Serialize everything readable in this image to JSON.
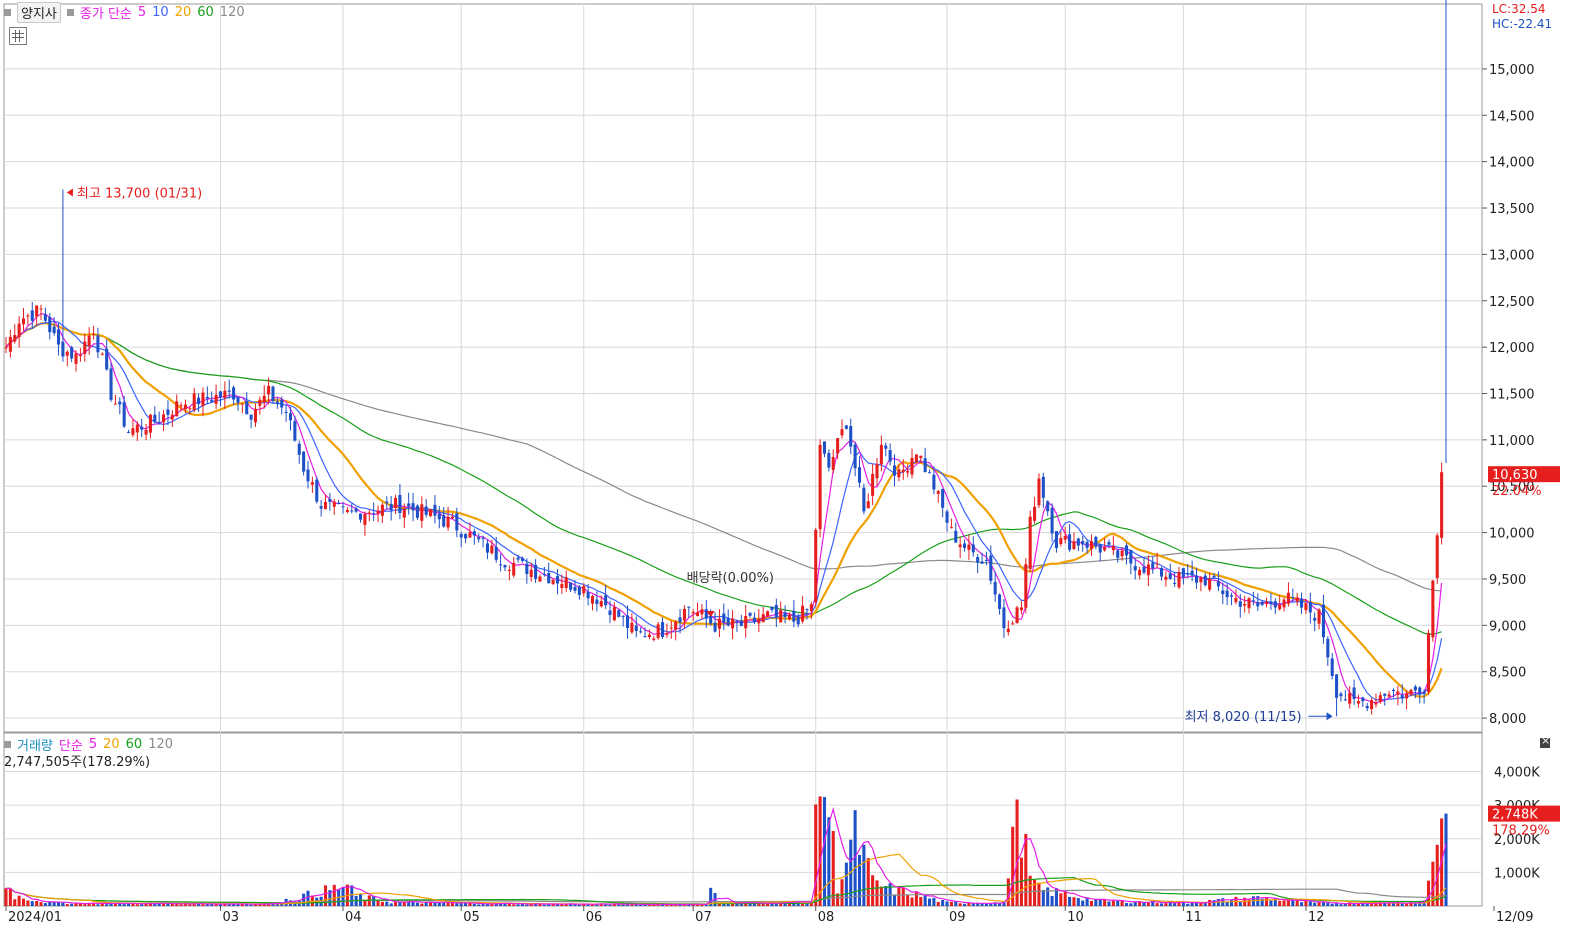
{
  "price_legend": {
    "name": "양지사",
    "label": "종가 단순",
    "ma": [
      {
        "label": "5",
        "color": "#e61ee6"
      },
      {
        "label": "10",
        "color": "#3c64ff"
      },
      {
        "label": "20",
        "color": "#f0a000"
      },
      {
        "label": "60",
        "color": "#18a018"
      },
      {
        "label": "120",
        "color": "#8a8a8a"
      }
    ]
  },
  "volume_legend": {
    "name": "거래량",
    "label": "단순",
    "ma": [
      {
        "label": "5",
        "color": "#e61ee6"
      },
      {
        "label": "20",
        "color": "#f0a000"
      },
      {
        "label": "60",
        "color": "#18a018"
      },
      {
        "label": "120",
        "color": "#8a8a8a"
      }
    ],
    "summary": "2,747,505주(178.29%)"
  },
  "corner": {
    "lc": "LC:32.54",
    "hc": "HC:-22.41"
  },
  "colors": {
    "up": "#e61e1e",
    "down": "#1e50c8",
    "grid": "#d8d8d8"
  },
  "chart_data": {
    "type": "candlestick",
    "x_labels": [
      "2024/01",
      "03",
      "04",
      "05",
      "06",
      "07",
      "08",
      "09",
      "10",
      "11",
      "12",
      "12/09"
    ],
    "y_axis_ticks": [
      "15,000",
      "14,500",
      "14,000",
      "13,500",
      "13,000",
      "12,500",
      "12,000",
      "11,500",
      "11,000",
      "10,500",
      "10,000",
      "9,500",
      "9,000",
      "8,500",
      "8,000"
    ],
    "ylim": [
      7850,
      15700
    ],
    "volume_axis_ticks": [
      "4,000K",
      "3,000K",
      "2,000K",
      "1,000K"
    ],
    "volume_ylim": [
      0,
      4700
    ],
    "current_price": {
      "value": "10,630",
      "change": "22.04%"
    },
    "current_volume": {
      "value": "2,748K",
      "change": "178.29%"
    },
    "annotations": {
      "high": "최고 13,700 (01/31)",
      "low": "최저 8,020 (11/15)",
      "dividend": "배당락(0.00%)"
    },
    "price_close_anchors": [
      [
        0,
        12000
      ],
      [
        3,
        12300
      ],
      [
        8,
        12400
      ],
      [
        12,
        12000
      ],
      [
        16,
        11900
      ],
      [
        20,
        12200
      ],
      [
        24,
        11500
      ],
      [
        28,
        11100
      ],
      [
        34,
        11200
      ],
      [
        40,
        11400
      ],
      [
        46,
        11450
      ],
      [
        52,
        11500
      ],
      [
        56,
        11300
      ],
      [
        60,
        11500
      ],
      [
        64,
        11300
      ],
      [
        68,
        10700
      ],
      [
        72,
        10300
      ],
      [
        78,
        10200
      ],
      [
        84,
        10250
      ],
      [
        90,
        10300
      ],
      [
        96,
        10200
      ],
      [
        102,
        10100
      ],
      [
        108,
        9900
      ],
      [
        114,
        9700
      ],
      [
        120,
        9600
      ],
      [
        126,
        9500
      ],
      [
        132,
        9400
      ],
      [
        138,
        9200
      ],
      [
        144,
        8900
      ],
      [
        150,
        8950
      ],
      [
        156,
        9200
      ],
      [
        162,
        9000
      ],
      [
        168,
        9000
      ],
      [
        174,
        9100
      ],
      [
        180,
        9050
      ],
      [
        184,
        9200
      ],
      [
        186,
        10900
      ],
      [
        188,
        10700
      ],
      [
        192,
        11200
      ],
      [
        196,
        10200
      ],
      [
        200,
        11000
      ],
      [
        204,
        10600
      ],
      [
        208,
        10900
      ],
      [
        212,
        10500
      ],
      [
        216,
        10000
      ],
      [
        220,
        9800
      ],
      [
        224,
        9700
      ],
      [
        228,
        9000
      ],
      [
        232,
        9200
      ],
      [
        234,
        10100
      ],
      [
        236,
        10600
      ],
      [
        240,
        9900
      ],
      [
        246,
        9900
      ],
      [
        252,
        9800
      ],
      [
        256,
        9700
      ],
      [
        262,
        9600
      ],
      [
        268,
        9500
      ],
      [
        274,
        9500
      ],
      [
        280,
        9300
      ],
      [
        286,
        9200
      ],
      [
        292,
        9300
      ],
      [
        296,
        9200
      ],
      [
        300,
        9100
      ],
      [
        304,
        8300
      ],
      [
        308,
        8150
      ],
      [
        312,
        8200
      ],
      [
        316,
        8300
      ],
      [
        320,
        8250
      ],
      [
        324,
        8350
      ],
      [
        328,
        10630
      ]
    ],
    "volume_anchors_k": [
      [
        0,
        700
      ],
      [
        2,
        300
      ],
      [
        10,
        100
      ],
      [
        20,
        80
      ],
      [
        40,
        70
      ],
      [
        60,
        60
      ],
      [
        78,
        600
      ],
      [
        80,
        300
      ],
      [
        88,
        120
      ],
      [
        100,
        90
      ],
      [
        120,
        60
      ],
      [
        150,
        50
      ],
      [
        160,
        50
      ],
      [
        161,
        550
      ],
      [
        163,
        80
      ],
      [
        184,
        120
      ],
      [
        186,
        4200
      ],
      [
        188,
        2800
      ],
      [
        190,
        600
      ],
      [
        194,
        2100
      ],
      [
        196,
        1500
      ],
      [
        198,
        700
      ],
      [
        202,
        500
      ],
      [
        206,
        400
      ],
      [
        215,
        100
      ],
      [
        228,
        100
      ],
      [
        230,
        2300
      ],
      [
        232,
        2400
      ],
      [
        234,
        800
      ],
      [
        236,
        500
      ],
      [
        240,
        400
      ],
      [
        250,
        150
      ],
      [
        270,
        100
      ],
      [
        286,
        250
      ],
      [
        300,
        80
      ],
      [
        320,
        100
      ],
      [
        324,
        150
      ],
      [
        326,
        1500
      ],
      [
        328,
        2748
      ]
    ]
  }
}
